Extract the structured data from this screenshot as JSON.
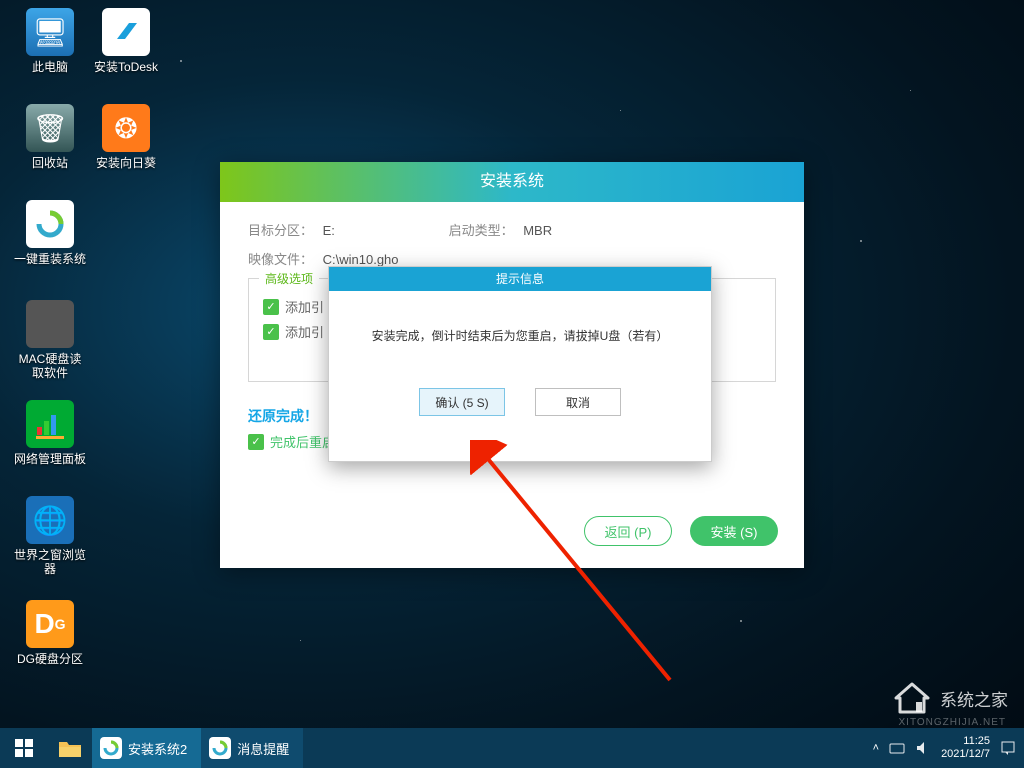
{
  "desktop": {
    "icons": [
      {
        "label": "此电脑"
      },
      {
        "label": "安装ToDesk"
      },
      {
        "label": "回收站"
      },
      {
        "label": "安装向日葵"
      },
      {
        "label": "一键重装系统"
      },
      {
        "label": "MAC硬盘读\n取软件"
      },
      {
        "label": "网络管理面板"
      },
      {
        "label": "世界之窗浏览\n器"
      },
      {
        "label": "DG硬盘分区"
      }
    ]
  },
  "main_window": {
    "title": "安装系统",
    "target_label": "目标分区：",
    "target_value": "E:",
    "boot_label": "启动类型：",
    "boot_value": "MBR",
    "image_label": "映像文件：",
    "image_value": "C:\\win10.gho",
    "advanced_legend": "高级选项",
    "chk_add1": "添加引",
    "chk_add2": "添加引",
    "restore_done": "还原完成！",
    "reboot_label": "完成后重启(R)",
    "btn_back": "返回 (P)",
    "btn_install": "安装 (S)"
  },
  "modal": {
    "title": "提示信息",
    "message": "安装完成，倒计时结束后为您重启，请拔掉U盘（若有）",
    "confirm": "确认 (5 S)",
    "cancel": "取消"
  },
  "taskbar": {
    "item1": "安装系统2",
    "item2": "消息提醒",
    "time": "11:25",
    "date": "2021/12/7"
  },
  "watermark": {
    "brand": "系统之家",
    "sub": "XITONGZHIJIA.NET"
  }
}
